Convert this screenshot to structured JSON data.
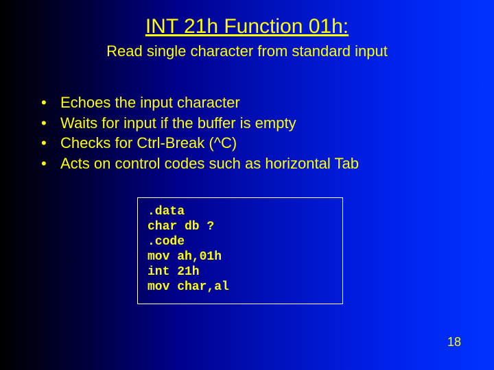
{
  "title": "INT 21h Function 01h:",
  "subtitle": "Read single character from standard input",
  "bullets": [
    "Echoes the input character",
    "Waits for input if the buffer is empty",
    "Checks for Ctrl-Break (^C)",
    "Acts on control codes such as horizontal Tab"
  ],
  "code_lines": [
    ".data",
    "char db ?",
    ".code",
    "mov ah,01h",
    "int 21h",
    "mov char,al"
  ],
  "page_number": "18"
}
